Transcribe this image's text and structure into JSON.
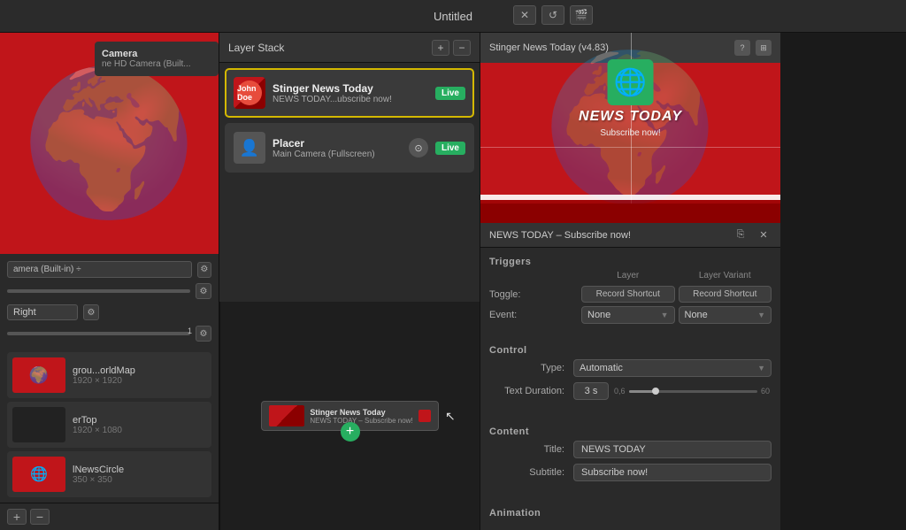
{
  "window": {
    "title": "Untitled",
    "controls": {
      "close_label": "✕",
      "refresh_label": "↺",
      "film_label": "🎬"
    }
  },
  "layer_stack": {
    "title": "Layer Stack",
    "add_btn": "+",
    "remove_btn": "−",
    "layers": [
      {
        "id": "stinger",
        "name": "Stinger News Today",
        "sub": "NEWS TODAY...ubscribe now!",
        "badge": "Live",
        "type": "stinger",
        "active": true
      },
      {
        "id": "placer",
        "name": "Placer",
        "sub": "Main Camera (Fullscreen)",
        "badge": "Live",
        "type": "placer",
        "active": false
      }
    ]
  },
  "canvas": {
    "node_name": "Stinger News Today",
    "node_sub": "NEWS TODAY – Subscribe now!"
  },
  "right_panel": {
    "preview_title": "Stinger News Today (v4.83)",
    "preview_news_title": "NEWS TODAY",
    "preview_subtitle": "Subscribe now!",
    "info_bar_text": "NEWS TODAY – Subscribe now!",
    "triggers": {
      "section_title": "Triggers",
      "col_layer": "Layer",
      "col_variant": "Layer Variant",
      "toggle_label": "Toggle:",
      "event_label": "Event:",
      "toggle_layer_btn": "Record Shortcut",
      "toggle_variant_btn": "Record Shortcut",
      "event_layer_value": "None",
      "event_variant_value": "None"
    },
    "control": {
      "section_title": "Control",
      "type_label": "Type:",
      "type_value": "Automatic",
      "duration_label": "Text Duration:",
      "duration_value": "3 s",
      "slider_min": "0,6",
      "slider_max": "60"
    },
    "content": {
      "section_title": "Content",
      "title_label": "Title:",
      "title_value": "NEWS TODAY",
      "subtitle_label": "Subtitle:",
      "subtitle_value": "Subscribe now!"
    },
    "animation": {
      "section_title": "Animation"
    }
  },
  "left_panel": {
    "camera_title": "Camera",
    "camera_sub": "ne HD Camera (Built...",
    "camera_setting": "amera (Built-in) ÷",
    "direction": "Right",
    "thumbnails": [
      {
        "name": "grou...orldMap",
        "size": "1920 × 1920",
        "type": "map"
      },
      {
        "name": "erTop",
        "size": "1920 × 1080",
        "type": "dark"
      },
      {
        "name": "lNewsCircle",
        "size": "350 × 350",
        "type": "globe"
      }
    ]
  }
}
